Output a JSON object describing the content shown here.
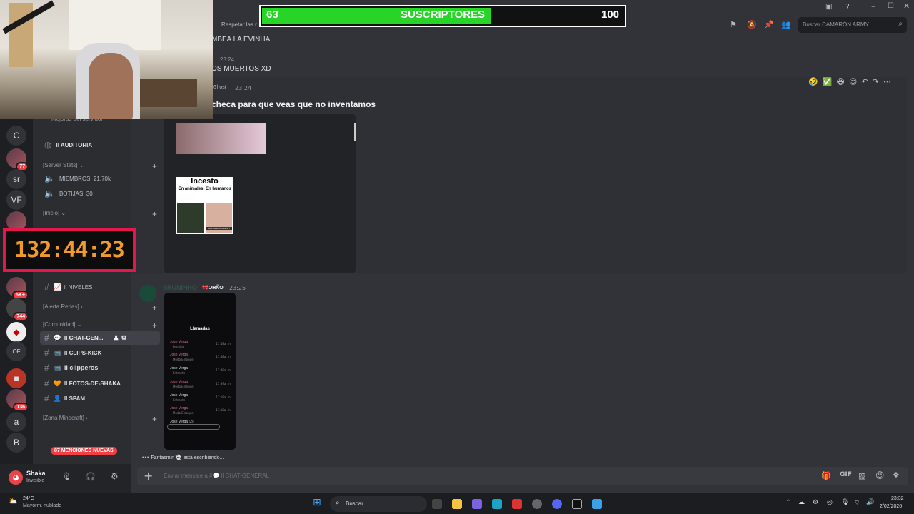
{
  "chat": {
    "channel_topic": "Respetar las r",
    "search_placeholder": "Buscar CAMARÓN ARMY",
    "messages": [
      {
        "text": "MBEA LA EVINHA"
      },
      {
        "time": "23:24",
        "text": "OS MUERTOS XD"
      },
      {
        "author": "Ghost",
        "time": "23:24",
        "text": "checa para que veas que no inventamos"
      }
    ],
    "embed_caption": {
      "title": "Incesto",
      "left": "En animales",
      "right": "En humanos",
      "footer": "CAMY BECRON ARMY"
    },
    "author2": "bRUNINHO",
    "role2": "OHÑO",
    "time2": "23:25",
    "phone": {
      "title": "Llamadas",
      "calls": [
        {
          "name": "Jose Verga",
          "sub": "Perdida",
          "time": "11:48a. m."
        },
        {
          "name": "Jose Verga",
          "sub": "Modo Enfoque",
          "time": "11:48a. m."
        },
        {
          "name": "Jose Verga",
          "sub": "Entrante",
          "time": "11:39a. m."
        },
        {
          "name": "Jose Verga",
          "sub": "Modo Enfoque",
          "time": "11:39a. m."
        },
        {
          "name": "Jose Verga",
          "sub": "Entrante",
          "time": "11:18a. m."
        },
        {
          "name": "Jose Verga",
          "sub": "Modo Enfoque",
          "time": "11:18a. m."
        },
        {
          "name": "Jose Verga (2)",
          "sub": "",
          "time": ""
        }
      ]
    },
    "typing": "Fantasmin 👻 está escribiendo...",
    "composer_placeholder": "Enviar mensaje a #💬 ll CHAT-GENERAL"
  },
  "channels": {
    "top_partial": "Mejoras del servidor",
    "auditoria": "ll AUDITORIA",
    "cat_server_stats": "[Server Stats]",
    "miembros": "MIEMBROS: 21.70k",
    "botijas": "BOTIJAS: 30",
    "cat_inicio": "[Inicio]",
    "niveles": "ll NIVELES",
    "cat_alerta": "[Alerta Redes]",
    "cat_comunidad": "[Comunidad]",
    "chat_general": "ll CHAT-GEN...",
    "clips_kick": "ll CLIPS-KICK",
    "clipperos": "ll clipperos",
    "fotos": "ll FOTOS-DE-SHAKA",
    "spam": "ll SPAM",
    "cat_minecraft": "[Zona Minecraft]",
    "mentions_pill": "87 MENCIONES NUEVAS"
  },
  "servers": [
    {
      "label": "C"
    },
    {
      "label": "sr"
    },
    {
      "label": "VF"
    },
    {
      "label": "a"
    },
    {
      "label": "B"
    },
    {
      "label": "OF"
    }
  ],
  "badges": {
    "b1": "77",
    "b2": "5K+",
    "b3": "744",
    "b4": "136"
  },
  "user": {
    "name": "Shaka",
    "status": "Invisible"
  },
  "overlay": {
    "subs_current": "63",
    "subs_label": "SUSCRIPTORES",
    "subs_goal": "100",
    "subs_progress": 0.63,
    "timer": "132:44:23"
  },
  "taskbar": {
    "weather_temp": "24°C",
    "weather_desc": "Mayorm. nublado",
    "search": "Buscar",
    "time": "23:32",
    "date": "2/02/2026"
  },
  "colors": {
    "accent_green": "#28d428",
    "timer_border": "#e3174d",
    "timer_text": "#f39a2c",
    "mention_red": "#f23f43"
  }
}
